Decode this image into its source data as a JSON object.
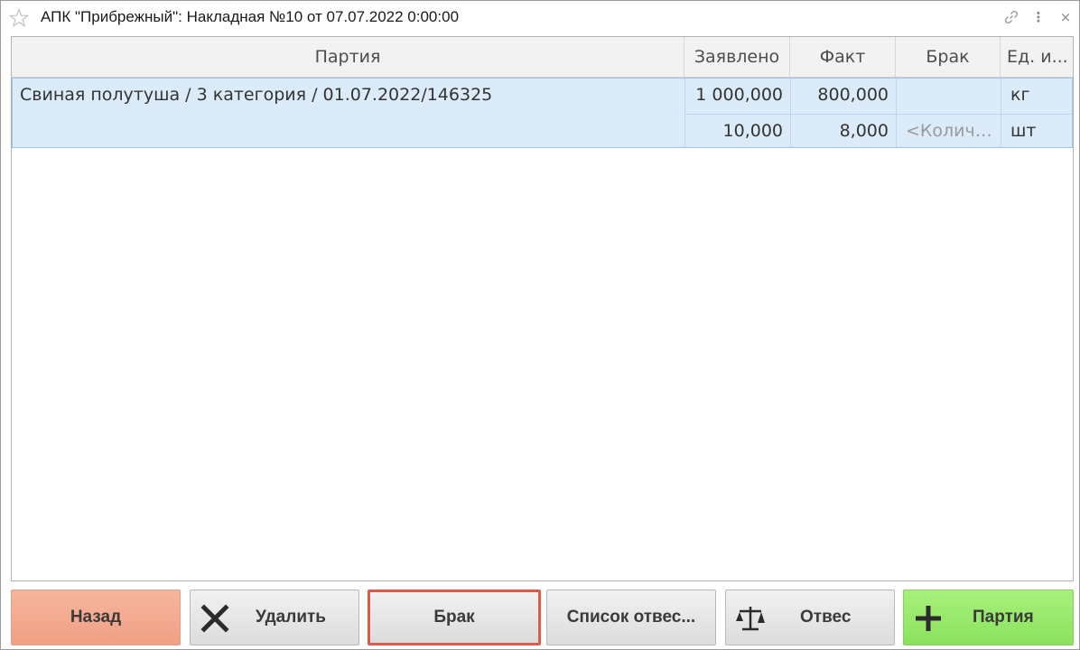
{
  "window": {
    "title": "АПК \"Прибрежный\": Накладная №10 от 07.07.2022 0:00:00",
    "icons": [
      "star-icon",
      "link-icon",
      "more-icon",
      "close-icon"
    ],
    "more_glyph": "⋮",
    "close_glyph": "×"
  },
  "table": {
    "columns": [
      "Партия",
      "Заявлено",
      "Факт",
      "Брак",
      "Ед. и..."
    ],
    "rows": [
      {
        "batch": "Свиная полутуша / 3 категория / 01.07.2022/146325",
        "lines": [
          {
            "declared": "1 000,000",
            "fact": "800,000",
            "defect": "",
            "unit": "кг"
          },
          {
            "declared": "10,000",
            "fact": "8,000",
            "defect_placeholder": "<Количе...",
            "unit": "шт"
          }
        ]
      }
    ],
    "colors": {
      "selected_bg": "#dcebfa",
      "selected_border": "#9cc4ec"
    }
  },
  "buttons": {
    "back": "Назад",
    "delete": "Удалить",
    "defect": "Брак",
    "list": "Список отвес...",
    "weigh": "Отвес",
    "batch": "Партия"
  },
  "colors": {
    "back": "#f3a98d",
    "batch": "#96e86a",
    "highlight": "#e05a4a"
  }
}
